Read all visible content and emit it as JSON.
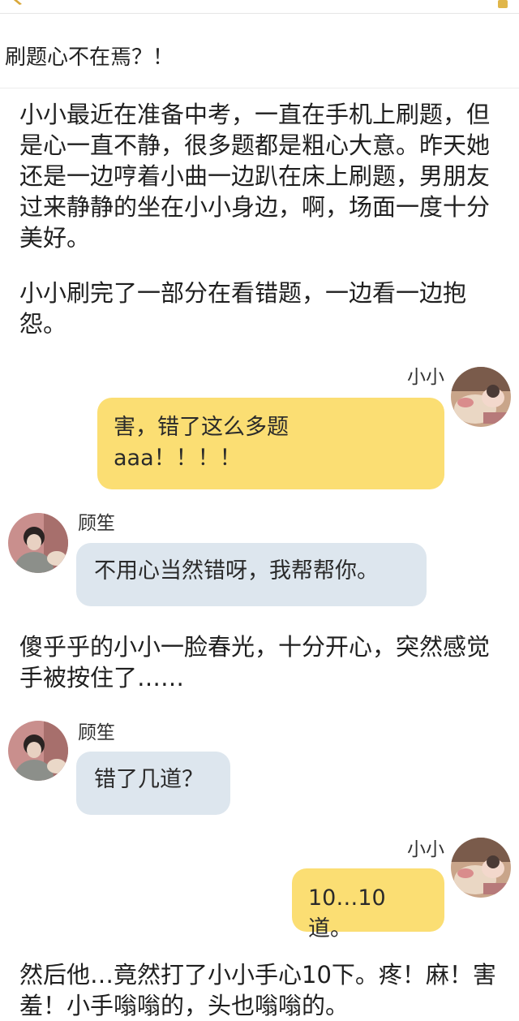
{
  "header": {
    "title": "刷题心不在焉？！"
  },
  "story": {
    "p1": "小小最近在准备中考，一直在手机上刷题，但是心一直不静，很多题都是粗心大意。昨天她还是一边哼着小曲一边趴在床上刷题，男朋友过来静静的坐在小小身边，啊，场面一度十分美好。",
    "p2": "小小刷完了一部分在看错题，一边看一边抱怨。",
    "p3": "傻乎乎的小小一脸春光，十分开心，突然感觉手被按住了……",
    "p4": "然后他…竟然打了小小手心10下。疼！麻！害羞！小手嗡嗡的，头也嗡嗡的。"
  },
  "chat": [
    {
      "speaker": "小小",
      "line1": "害，错了这么多题",
      "line2": "aaa！！！！"
    },
    {
      "speaker": "顾笙",
      "text": "不用心当然错呀，我帮帮你。"
    },
    {
      "speaker": "顾笙",
      "text": "错了几道？"
    },
    {
      "speaker": "小小",
      "text": "10…10道。"
    }
  ],
  "colors": {
    "bubble_right": "#fbde73",
    "bubble_left": "#dde6ee"
  }
}
